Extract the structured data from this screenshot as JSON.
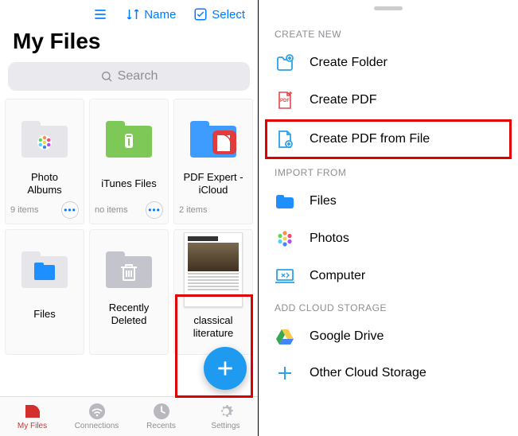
{
  "left": {
    "toolbar": {
      "sort_label": "Name",
      "select_label": "Select"
    },
    "title": "My Files",
    "search_placeholder": "Search",
    "cells": [
      {
        "label": "Photo\nAlbums",
        "footer": "9 items",
        "show_more": true
      },
      {
        "label": "iTunes Files",
        "footer": "no items",
        "show_more": true
      },
      {
        "label": "PDF Expert -\niCloud",
        "footer": "2 items",
        "show_more": false
      },
      {
        "label": "Files",
        "footer": "",
        "show_more": false
      },
      {
        "label": "Recently\nDeleted",
        "footer": "",
        "show_more": false
      },
      {
        "label": "classical\nliterature",
        "footer": "",
        "show_more": false
      }
    ],
    "tabs": [
      {
        "label": "My Files"
      },
      {
        "label": "Connections"
      },
      {
        "label": "Recents"
      },
      {
        "label": "Settings"
      }
    ]
  },
  "right": {
    "sections": {
      "create": "CREATE NEW",
      "import": "IMPORT FROM",
      "cloud": "ADD CLOUD STORAGE"
    },
    "items": {
      "create_folder": "Create Folder",
      "create_pdf": "Create PDF",
      "create_pdf_from_file": "Create PDF from File",
      "files": "Files",
      "photos": "Photos",
      "computer": "Computer",
      "google_drive": "Google Drive",
      "other_cloud": "Other Cloud Storage"
    }
  }
}
